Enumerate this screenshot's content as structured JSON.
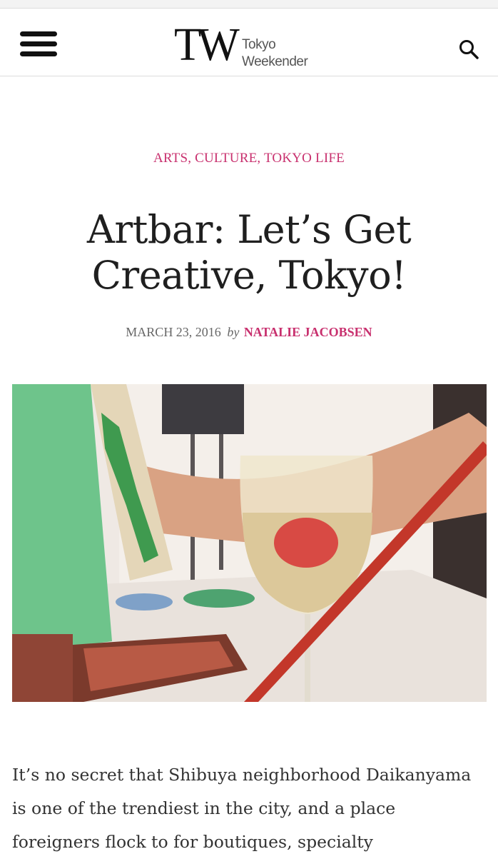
{
  "header": {
    "logo_mono": "TW",
    "logo_line1": "Tokyo",
    "logo_line2": "Weekender",
    "menu_icon": "hamburger-menu-icon",
    "search_icon": "search-icon"
  },
  "article": {
    "categories": "ARTS, CULTURE, TOKYO LIFE",
    "title": "Artbar: Let’s Get Creative, Tokyo!",
    "date": "MARCH 23, 2016",
    "by": "by",
    "author": "NATALIE JACOBSEN",
    "hero_image": "artbar-painting-wine-glass-photo",
    "body": "It’s no secret that Shibuya neighborhood Daikanyama is one of the trendiest in the city, and a place foreigners flock to for boutiques, specialty"
  },
  "colors": {
    "accent": "#c8306e",
    "text": "#2a2a2a",
    "muted": "#666666",
    "border": "#dcdcdc"
  }
}
